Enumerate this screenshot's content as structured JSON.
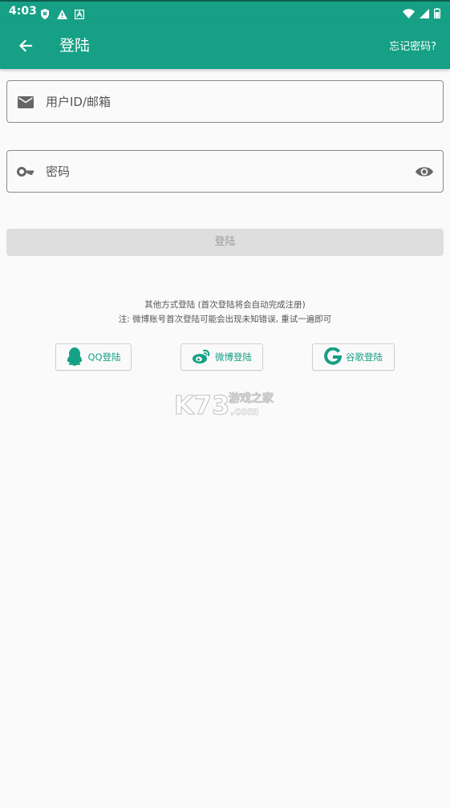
{
  "status_bar": {
    "time": "4:03",
    "left_icons": [
      "shield-icon",
      "warning-icon",
      "notification-icon"
    ],
    "right_icons": [
      "wifi-icon",
      "signal-icon",
      "battery-icon"
    ]
  },
  "app_bar": {
    "title": "登陆",
    "forgot_password": "忘记密码?"
  },
  "form": {
    "user_placeholder": "用户ID/邮箱",
    "password_placeholder": "密码",
    "login_button": "登陆"
  },
  "other_login": {
    "line1": "其他方式登陆 (首次登陆将会自动完成注册)",
    "line2": "注: 微博账号首次登陆可能会出现未知错误, 重试一遍即可",
    "buttons": [
      {
        "label": "QQ登陆",
        "icon": "qq-icon"
      },
      {
        "label": "微博登陆",
        "icon": "weibo-icon"
      },
      {
        "label": "谷歌登陆",
        "icon": "google-icon"
      }
    ]
  },
  "watermark": {
    "brand": "K73",
    "text": "游戏之家",
    "domain": ".com"
  },
  "colors": {
    "primary": "#16a085",
    "background": "#fafafa",
    "disabled_button": "#dedede"
  }
}
